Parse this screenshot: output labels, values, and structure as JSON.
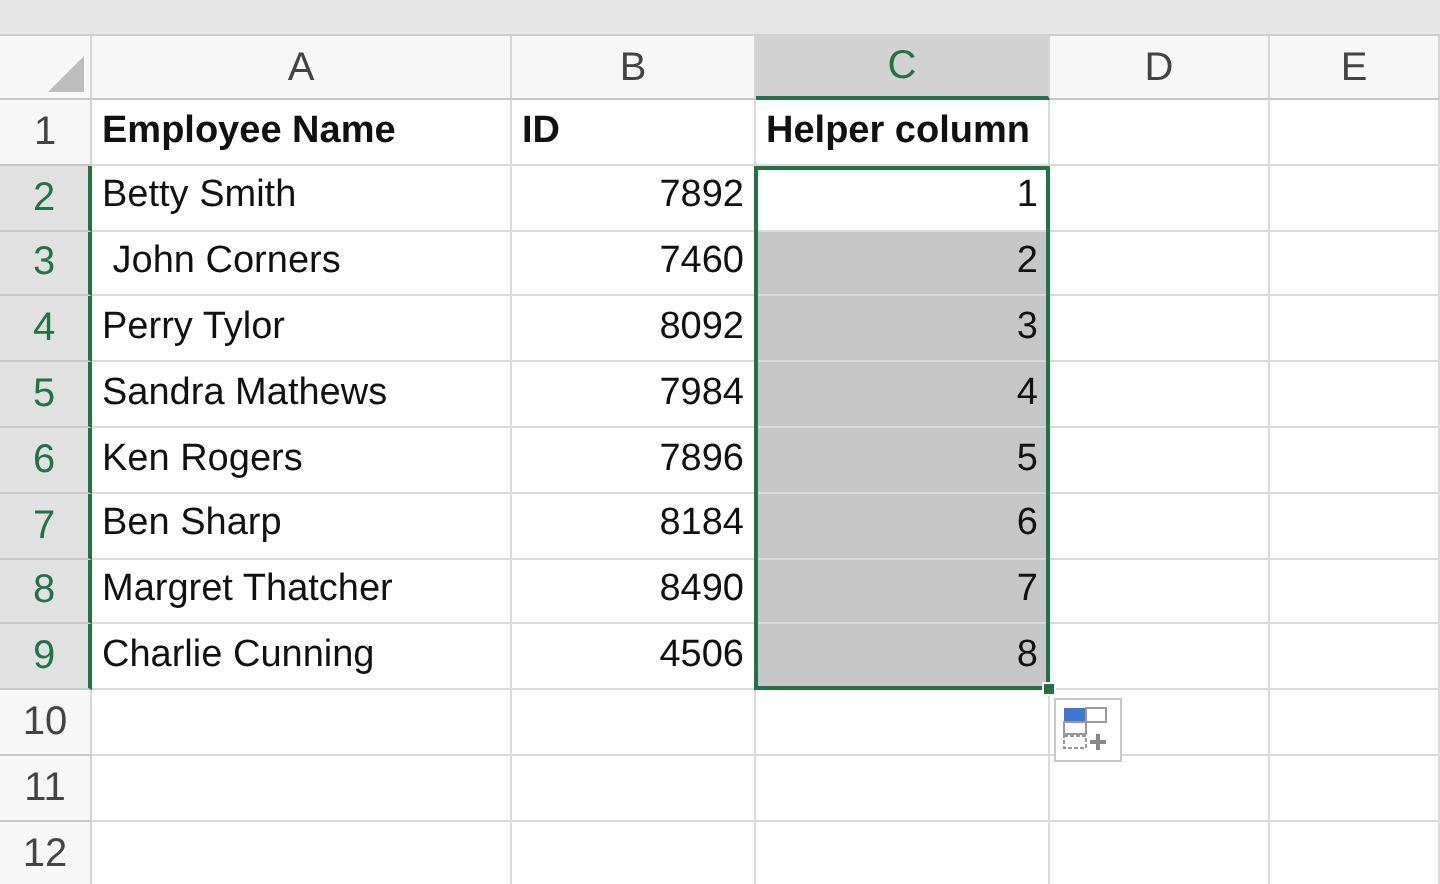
{
  "columns": [
    {
      "label": "A",
      "selected": false
    },
    {
      "label": "B",
      "selected": false
    },
    {
      "label": "C",
      "selected": true
    },
    {
      "label": "D",
      "selected": false
    },
    {
      "label": "E",
      "selected": false
    }
  ],
  "rows": [
    {
      "number": "1",
      "selected": false,
      "kind": "header",
      "cells": [
        {
          "text": "Employee Name",
          "kind": "text"
        },
        {
          "text": "ID",
          "kind": "text"
        },
        {
          "text": "Helper column",
          "kind": "text"
        }
      ]
    },
    {
      "number": "2",
      "selected": true,
      "cells": [
        {
          "text": "Betty Smith",
          "kind": "text"
        },
        {
          "text": "7892",
          "kind": "number"
        },
        {
          "text": "1",
          "kind": "number",
          "selected": true,
          "active": true
        }
      ]
    },
    {
      "number": "3",
      "selected": true,
      "cells": [
        {
          "text": " John Corners",
          "kind": "text"
        },
        {
          "text": "7460",
          "kind": "number"
        },
        {
          "text": "2",
          "kind": "number",
          "selected": true,
          "active": false
        }
      ]
    },
    {
      "number": "4",
      "selected": true,
      "cells": [
        {
          "text": "Perry Tylor",
          "kind": "text"
        },
        {
          "text": "8092",
          "kind": "number"
        },
        {
          "text": "3",
          "kind": "number",
          "selected": true,
          "active": false
        }
      ]
    },
    {
      "number": "5",
      "selected": true,
      "cells": [
        {
          "text": "Sandra Mathews",
          "kind": "text"
        },
        {
          "text": "7984",
          "kind": "number"
        },
        {
          "text": "4",
          "kind": "number",
          "selected": true,
          "active": false
        }
      ]
    },
    {
      "number": "6",
      "selected": true,
      "cells": [
        {
          "text": "Ken Rogers",
          "kind": "text"
        },
        {
          "text": "7896",
          "kind": "number"
        },
        {
          "text": "5",
          "kind": "number",
          "selected": true,
          "active": false
        }
      ]
    },
    {
      "number": "7",
      "selected": true,
      "cells": [
        {
          "text": "Ben Sharp",
          "kind": "text"
        },
        {
          "text": "8184",
          "kind": "number"
        },
        {
          "text": "6",
          "kind": "number",
          "selected": true,
          "active": false
        }
      ]
    },
    {
      "number": "8",
      "selected": true,
      "cells": [
        {
          "text": "Margret Thatcher",
          "kind": "text"
        },
        {
          "text": "8490",
          "kind": "number"
        },
        {
          "text": "7",
          "kind": "number",
          "selected": true,
          "active": false
        }
      ]
    },
    {
      "number": "9",
      "selected": true,
      "cells": [
        {
          "text": "Charlie Cunning",
          "kind": "text"
        },
        {
          "text": "4506",
          "kind": "number"
        },
        {
          "text": "8",
          "kind": "number",
          "selected": true,
          "active": false
        }
      ]
    },
    {
      "number": "10",
      "selected": false,
      "cells": []
    },
    {
      "number": "11",
      "selected": false,
      "cells": []
    },
    {
      "number": "12",
      "selected": false,
      "cells": []
    }
  ]
}
